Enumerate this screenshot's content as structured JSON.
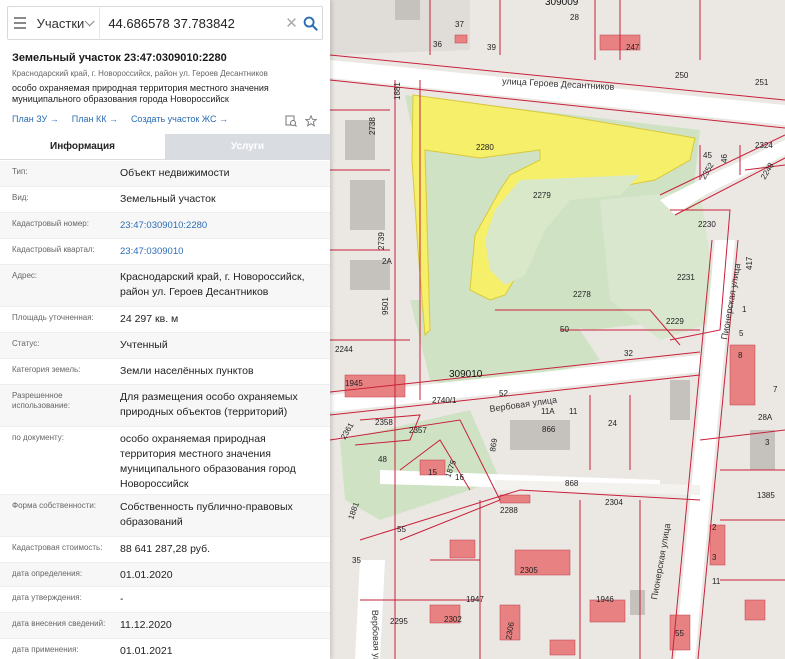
{
  "search": {
    "category": "Участки",
    "query": "44.686578 37.783842",
    "clear_glyph": "✕"
  },
  "parcel": {
    "title": "Земельный участок 23:47:0309010:2280",
    "address_short": "Краснодарский край, г. Новороссийск, район ул. Героев Десантников",
    "description": "особо охраняемая природная территория местного значения муниципального образования города Новороссийск",
    "links": [
      {
        "label": "План ЗУ →"
      },
      {
        "label": "План КК →"
      },
      {
        "label": "Создать участок ЖС →"
      }
    ]
  },
  "tabs": [
    {
      "label": "Информация",
      "active": true
    },
    {
      "label": "Услуги",
      "active": false
    }
  ],
  "info_rows": [
    {
      "key": "Тип:",
      "value": "Объект недвижимости"
    },
    {
      "key": "Вид:",
      "value": "Земельный участок"
    },
    {
      "key": "Кадастровый номер:",
      "value": "23:47:0309010:2280",
      "link": true
    },
    {
      "key": "Кадастровый квартал:",
      "value": "23:47:0309010",
      "link": true
    },
    {
      "key": "Адрес:",
      "value": "Краснодарский край, г. Новороссийск, район ул. Героев Десантников"
    },
    {
      "key": "Площадь уточненная:",
      "value": "24 297 кв. м"
    },
    {
      "key": "Статус:",
      "value": "Учтенный"
    },
    {
      "key": "Категория земель:",
      "value": "Земли населённых пунктов"
    },
    {
      "key": "Разрешенное использование:",
      "value": "Для размещения особо охраняемых природных объектов (территорий)"
    },
    {
      "key": "по документу:",
      "value": "особо охраняемая природная территория местного значения муниципального образования город Новороссийск"
    },
    {
      "key": "Форма собственности:",
      "value": "Собственность публично-правовых образований"
    },
    {
      "key": "Кадастровая стоимость:",
      "value": "88 641 287,28 руб."
    },
    {
      "key": "дата определения:",
      "value": "01.01.2020"
    },
    {
      "key": "дата утверждения:",
      "value": "-"
    },
    {
      "key": "дата внесения сведений:",
      "value": "11.12.2020"
    },
    {
      "key": "дата применения:",
      "value": "01.01.2021"
    }
  ],
  "map": {
    "streets": {
      "geroev": "улица Героев Десантников",
      "verbovaya": "Вербовая улица",
      "verbovaya_v": "Вербовая ул.",
      "pionerskaya": "Пионерская улица",
      "pionerskaya_top": "Пионерская улица"
    },
    "labels": [
      "309009",
      "37",
      "36",
      "28",
      "247",
      "39",
      "250",
      "251",
      "1881",
      "2738",
      "2280",
      "2279",
      "2739",
      "2A",
      "9501",
      "2278",
      "50",
      "2231",
      "2229",
      "2230",
      "2324",
      "45",
      "46",
      "2352",
      "2248",
      "417",
      "2244",
      "1945",
      "309010",
      "32",
      "52",
      "2740/1",
      "2358",
      "2357",
      "2361",
      "866",
      "11A",
      "11",
      "24",
      "869",
      "48",
      "1875",
      "868",
      "2288",
      "2304",
      "55",
      "35",
      "1881",
      "2305",
      "1947",
      "2302",
      "2306",
      "2295",
      "1946",
      "55",
      "1385",
      "28A",
      "8",
      "5",
      "1",
      "7",
      "3",
      "2",
      "3",
      "11",
      "15",
      "16"
    ]
  },
  "colors": {
    "accent": "#2a6db5",
    "selected_parcel": "#f5ef6a",
    "boundary": "#c8203a",
    "park": "#cde3c0",
    "building": "#e57575"
  }
}
